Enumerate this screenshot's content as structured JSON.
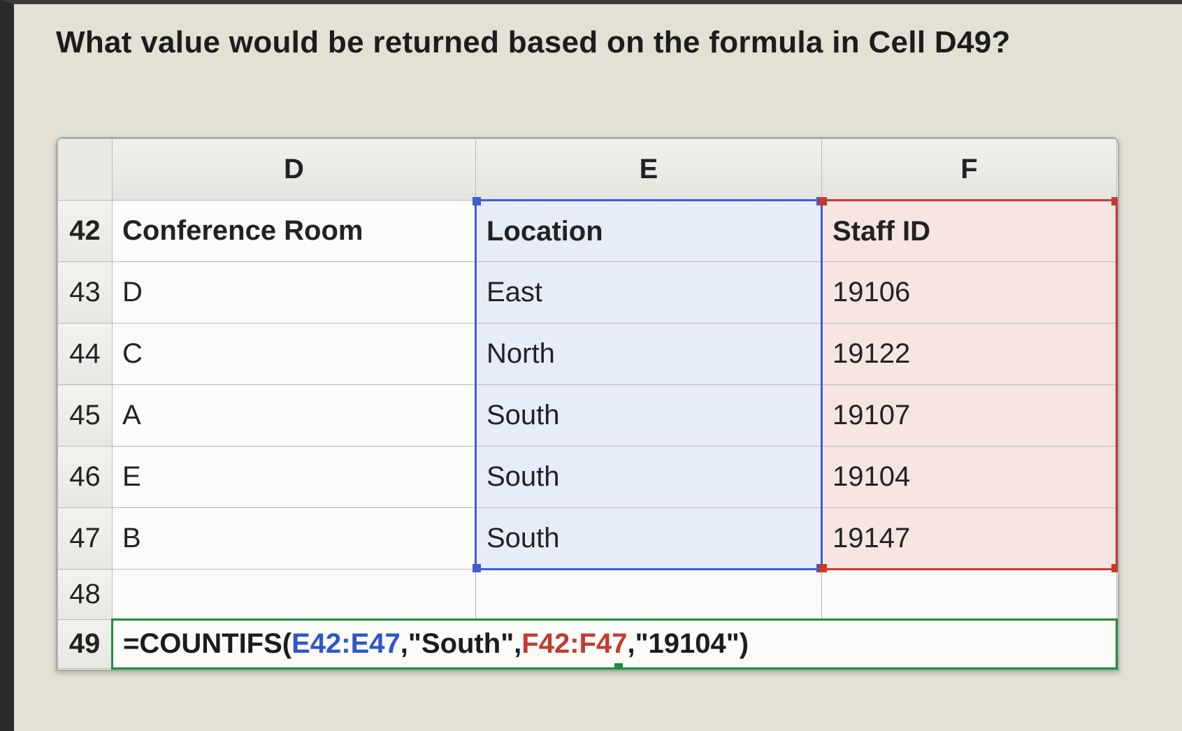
{
  "question": "What value would be returned based on the formula in Cell D49?",
  "columns": {
    "D": "D",
    "E": "E",
    "F": "F"
  },
  "headers": {
    "confRoom": "Conference Room",
    "location": "Location",
    "staffId": "Staff ID"
  },
  "rows": {
    "r42": "42",
    "r43": "43",
    "r44": "44",
    "r45": "45",
    "r46": "46",
    "r47": "47",
    "r48": "48",
    "r49": "49"
  },
  "data": {
    "d43": "D",
    "e43": "East",
    "f43": "19106",
    "d44": "C",
    "e44": "North",
    "f44": "19122",
    "d45": "A",
    "e45": "South",
    "f45": "19107",
    "d46": "E",
    "e46": "South",
    "f46": "19104",
    "d47": "B",
    "e47": "South",
    "f47": "19147"
  },
  "formula": {
    "eq": "=",
    "fn": "COUNTIFS(",
    "range1": "E42:E47",
    "c1": ",",
    "crit1": "\"South\"",
    "c2": ",",
    "range2": "F42:F47",
    "c3": ",",
    "crit2": "\"19104\"",
    "close": ")"
  },
  "chart_data": {
    "type": "table",
    "description": "Spreadsheet snippet with a COUNTIFS formula",
    "columns": [
      "D (Conference Room)",
      "E (Location)",
      "F (Staff ID)"
    ],
    "rows": [
      {
        "row": 42,
        "D": "Conference Room",
        "E": "Location",
        "F": "Staff ID"
      },
      {
        "row": 43,
        "D": "D",
        "E": "East",
        "F": 19106
      },
      {
        "row": 44,
        "D": "C",
        "E": "North",
        "F": 19122
      },
      {
        "row": 45,
        "D": "A",
        "E": "South",
        "F": 19107
      },
      {
        "row": 46,
        "D": "E",
        "E": "South",
        "F": 19104
      },
      {
        "row": 47,
        "D": "B",
        "E": "South",
        "F": 19147
      }
    ],
    "formula_cell": "D49",
    "formula": "=COUNTIFS(E42:E47,\"South\",F42:F47,\"19104\")",
    "highlighted_ranges": {
      "blue": "E42:E47",
      "red": "F42:F47"
    }
  }
}
